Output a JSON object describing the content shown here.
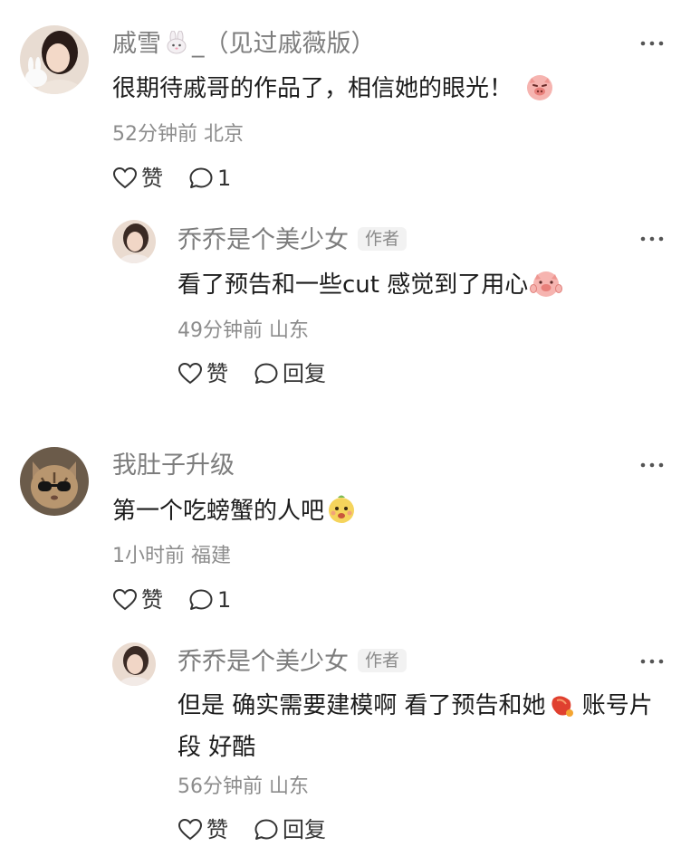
{
  "comments": [
    {
      "user": "戚雪",
      "user_suffix": "_（见过戚薇版）",
      "text": "很期待戚哥的作品了，相信她的眼光！",
      "meta": "52分钟前 北京",
      "like_label": "赞",
      "comment_count": "1",
      "replies": [
        {
          "user": "乔乔是个美少女",
          "badge": "作者",
          "text": "看了预告和一些cut 感觉到了用心",
          "meta": "49分钟前 山东",
          "like_label": "赞",
          "reply_label": "回复"
        }
      ]
    },
    {
      "user": "我肚子升级",
      "text": "第一个吃螃蟹的人吧",
      "meta": "1小时前 福建",
      "like_label": "赞",
      "comment_count": "1",
      "replies": [
        {
          "user": "乔乔是个美少女",
          "badge": "作者",
          "text": "但是 确实需要建模啊 看了预告和她",
          "text_after_emoji": " 账号片段 好酷",
          "meta": "56分钟前 山东",
          "like_label": "赞",
          "reply_label": "回复"
        }
      ]
    }
  ]
}
